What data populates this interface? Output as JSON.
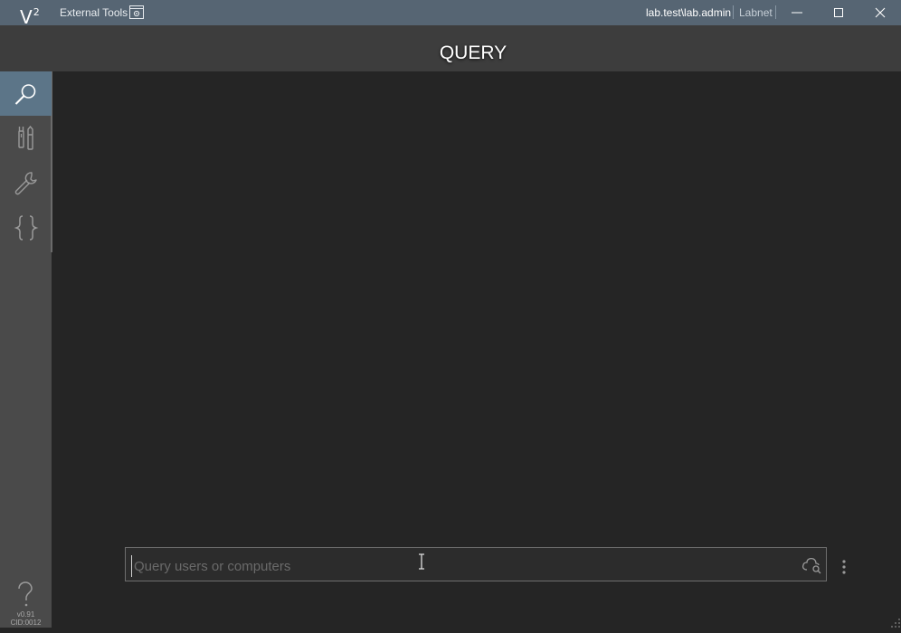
{
  "titlebar": {
    "logo": "V",
    "logo_sup": "2",
    "external_tools": "External Tools",
    "user": "lab.test\\lab.admin",
    "domain": "Labnet"
  },
  "header": {
    "title": "QUERY"
  },
  "sidebar": {
    "items": [
      {
        "name": "query",
        "icon": "search-icon",
        "active": true
      },
      {
        "name": "tools",
        "icon": "tools-icon",
        "active": false
      },
      {
        "name": "settings",
        "icon": "wrench-icon",
        "active": false
      },
      {
        "name": "scripts",
        "icon": "braces-icon",
        "active": false
      }
    ],
    "help_icon": "question-mark-icon",
    "version": "v0.91",
    "cid": "CID:0012"
  },
  "query": {
    "placeholder": "Query users or computers",
    "value": ""
  },
  "colors": {
    "titlebar": "#566573",
    "header": "#3d3d3d",
    "sidebar": "#4a4a4a",
    "active_nav": "#5c7588",
    "background": "#252525"
  }
}
